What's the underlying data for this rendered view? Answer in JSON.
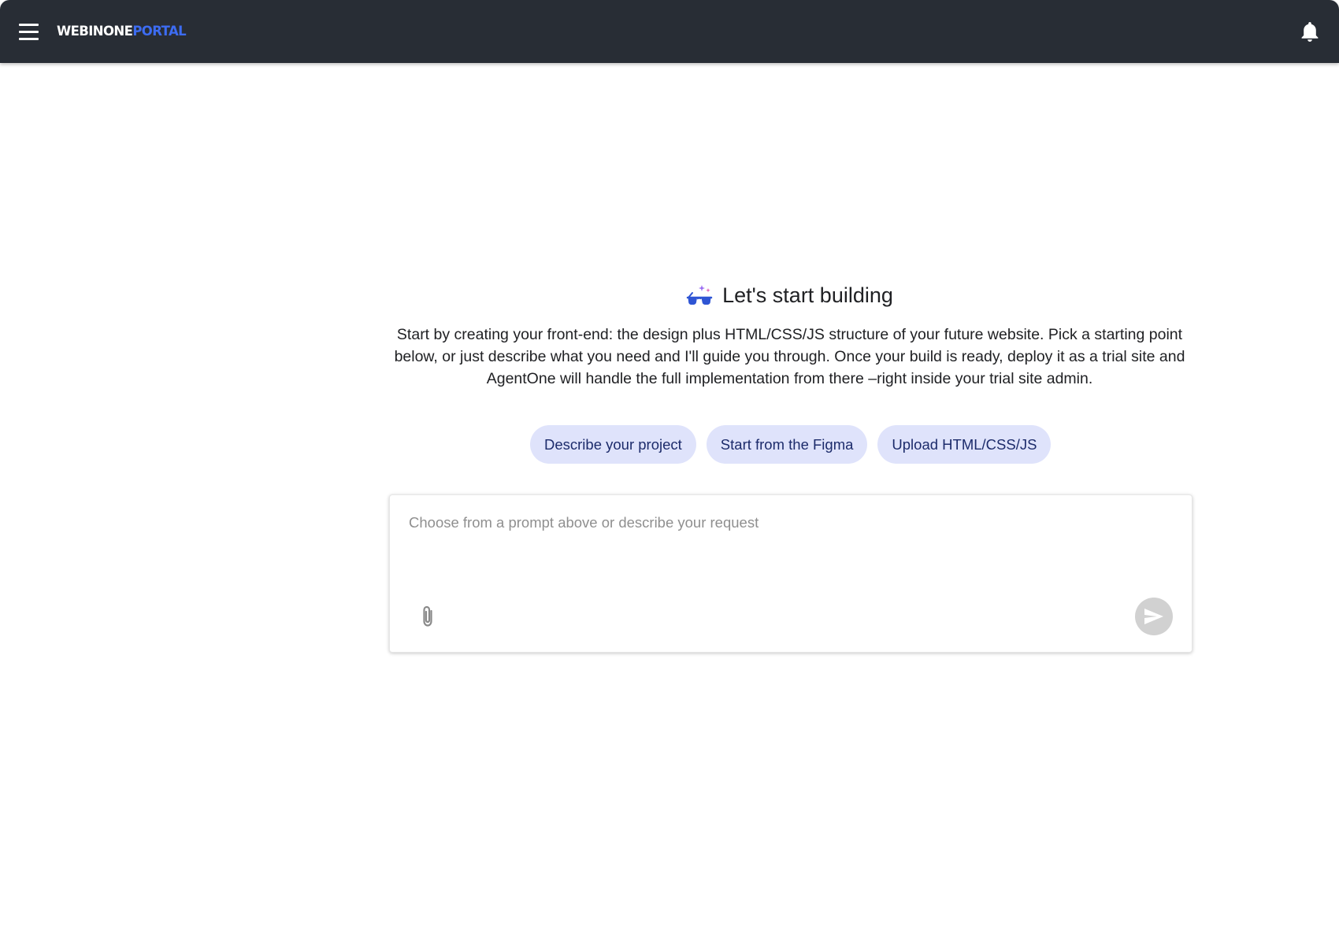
{
  "topbar": {
    "brand_part1": "WEBINONE",
    "brand_part2": "PORTAL",
    "menu_icon": "hamburger-menu-icon",
    "notification_icon": "bell-icon"
  },
  "hero": {
    "icon": "sparkle-glasses-icon",
    "title": "Let's start building",
    "description": "Start by creating your front-end: the design plus HTML/CSS/JS structure of your future website. Pick a starting point below, or just describe what you need and I'll guide you through. Once your build is ready, deploy it as a trial site and AgentOne will handle the full implementation from there –right inside your trial site admin."
  },
  "chips": [
    {
      "label": "Describe your project"
    },
    {
      "label": "Start from the Figma"
    },
    {
      "label": "Upload HTML/CSS/JS"
    }
  ],
  "composer": {
    "placeholder": "Choose from a prompt above or describe your request",
    "value": "",
    "attach_icon": "paperclip-icon",
    "send_icon": "send-icon"
  },
  "colors": {
    "topbar_bg": "#282d35",
    "brand_accent": "#3d6cf2",
    "chip_bg": "#dfe3fb",
    "chip_text": "#1c2b6b",
    "send_disabled": "#d1d1d1"
  }
}
